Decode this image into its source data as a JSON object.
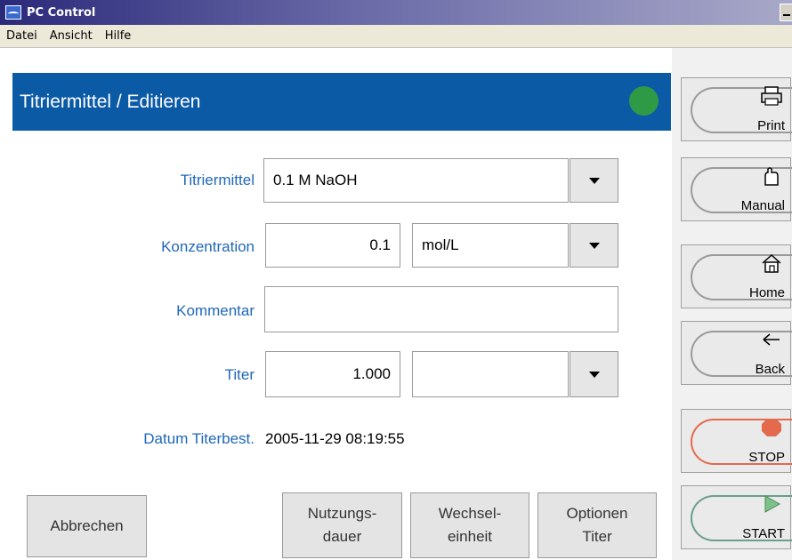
{
  "window": {
    "title": "PC Control"
  },
  "menu": {
    "items": [
      "Datei",
      "Ansicht",
      "Hilfe"
    ]
  },
  "header": {
    "title": "Titriermittel / Editieren",
    "status_color": "#2e9a46"
  },
  "form": {
    "titriermittel": {
      "label": "Titriermittel",
      "value": "0.1 M NaOH"
    },
    "konzentration": {
      "label": "Konzentration",
      "value": "0.1",
      "unit": "mol/L"
    },
    "kommentar": {
      "label": "Kommentar",
      "value": ""
    },
    "titer": {
      "label": "Titer",
      "value": "1.000",
      "unit": ""
    },
    "datum": {
      "label": "Datum Titerbest.",
      "value": "2005-11-29 08:19:55"
    }
  },
  "buttons": {
    "abbrechen": "Abbrechen",
    "nutzungsdauer": "Nutzungs-\ndauer",
    "wechseleinheit": "Wechsel-\neinheit",
    "optionen_titer": "Optionen\nTiter"
  },
  "side": {
    "print": {
      "label": "Print",
      "icon": "printer-icon"
    },
    "manual": {
      "label": "Manual",
      "icon": "hand-icon"
    },
    "home": {
      "label": "Home",
      "icon": "house-icon"
    },
    "back": {
      "label": "Back",
      "icon": "back-arrow-icon"
    },
    "stop": {
      "label": "STOP",
      "icon": "stop-icon",
      "color": "#e46a4e"
    },
    "start": {
      "label": "START",
      "icon": "play-icon",
      "color": "#6aa08a"
    }
  }
}
